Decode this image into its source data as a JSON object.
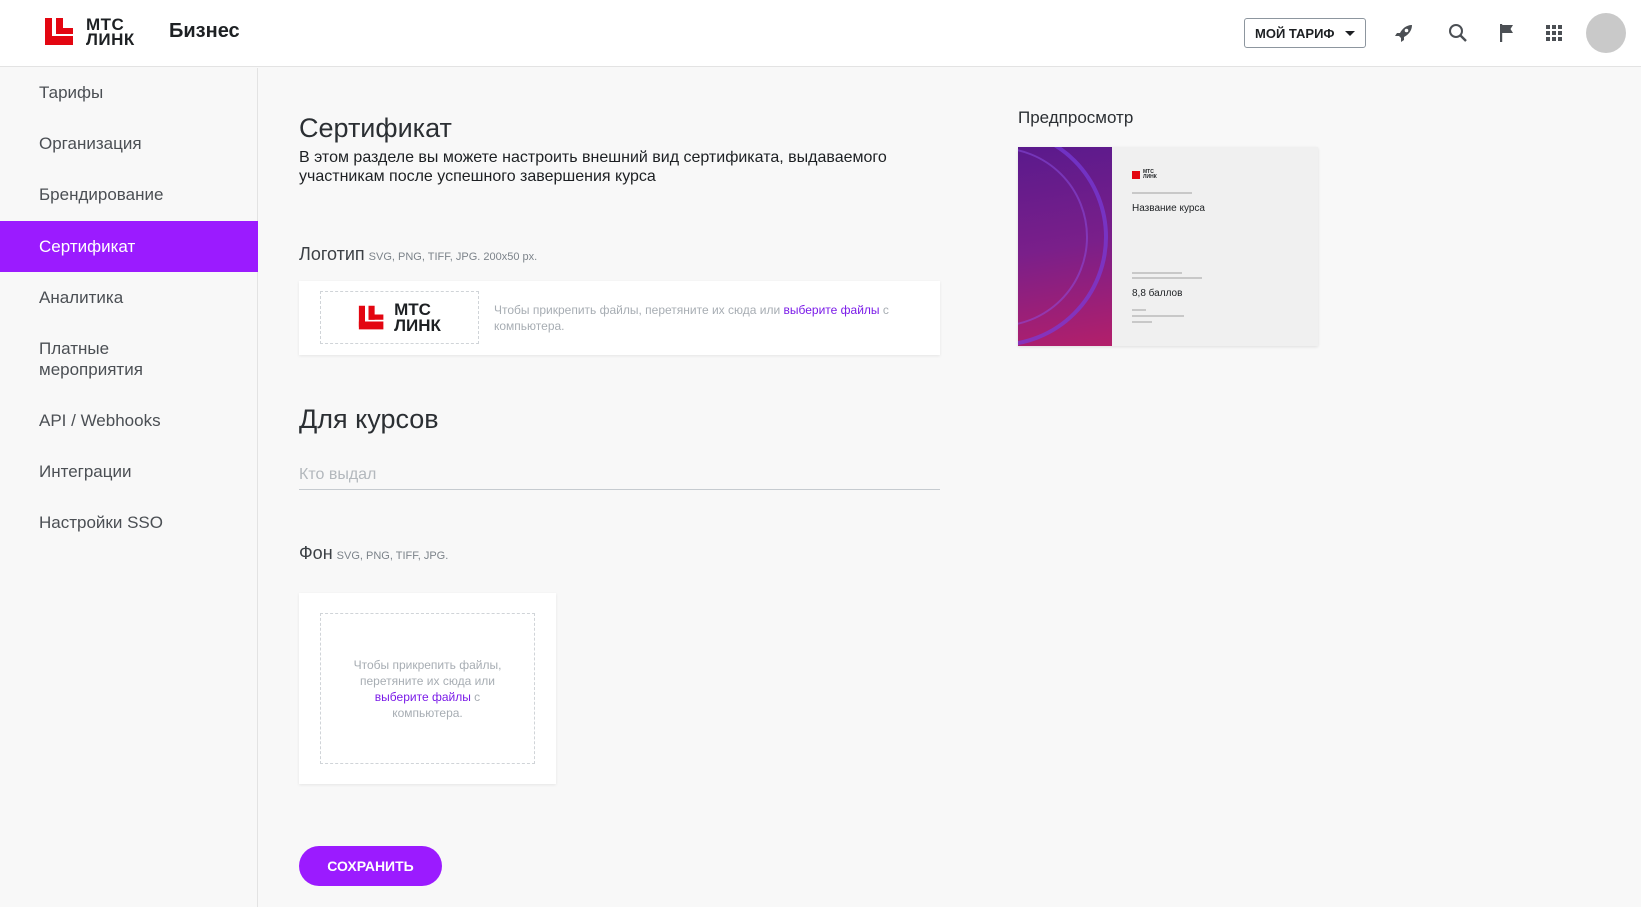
{
  "header": {
    "brand_line1": "МТС",
    "brand_line2": "ЛИНК",
    "product": "Бизнес",
    "tariff_button": "МОЙ ТАРИФ",
    "icons": [
      "rocket-icon",
      "search-icon",
      "flag-icon",
      "apps-grid-icon"
    ],
    "brand_color": "#e30611"
  },
  "sidebar": {
    "items": [
      {
        "label": "Тарифы"
      },
      {
        "label": "Организация"
      },
      {
        "label": "Брендирование"
      },
      {
        "label": "Сертификат"
      },
      {
        "label": "Аналитика"
      },
      {
        "label": "Платные мероприятия"
      },
      {
        "label": "API / Webhooks"
      },
      {
        "label": "Интеграции"
      },
      {
        "label": "Настройки SSO"
      }
    ],
    "active_index": 3,
    "active_color": "#9b1bff"
  },
  "main": {
    "title": "Сертификат",
    "subtitle": "В этом разделе вы можете настроить внешний вид сертификата, выдаваемого участникам после успешного завершения курса",
    "logo_section": {
      "label": "Логотип",
      "hint": "SVG, PNG, TIFF, JPG. 200x50 px.",
      "drop_text_before": "Чтобы прикрепить файлы, перетяните их сюда или ",
      "drop_link": "выберите файлы",
      "drop_text_after": " с компьютера."
    },
    "courses_heading": "Для курсов",
    "issuer_field": {
      "placeholder": "Кто выдал",
      "value": ""
    },
    "background_section": {
      "label": "Фон",
      "hint": "SVG, PNG, TIFF, JPG.",
      "drop_text_before": "Чтобы прикрепить файлы, перетяните их сюда или ",
      "drop_link": "выберите файлы",
      "drop_text_after": " с компьютера."
    },
    "save_button": "СОХРАНИТЬ"
  },
  "preview": {
    "label": "Предпросмотр",
    "brand_line1": "МТС",
    "brand_line2": "ЛИНК",
    "course_name": "Название курса",
    "score": "8,8 баллов"
  }
}
